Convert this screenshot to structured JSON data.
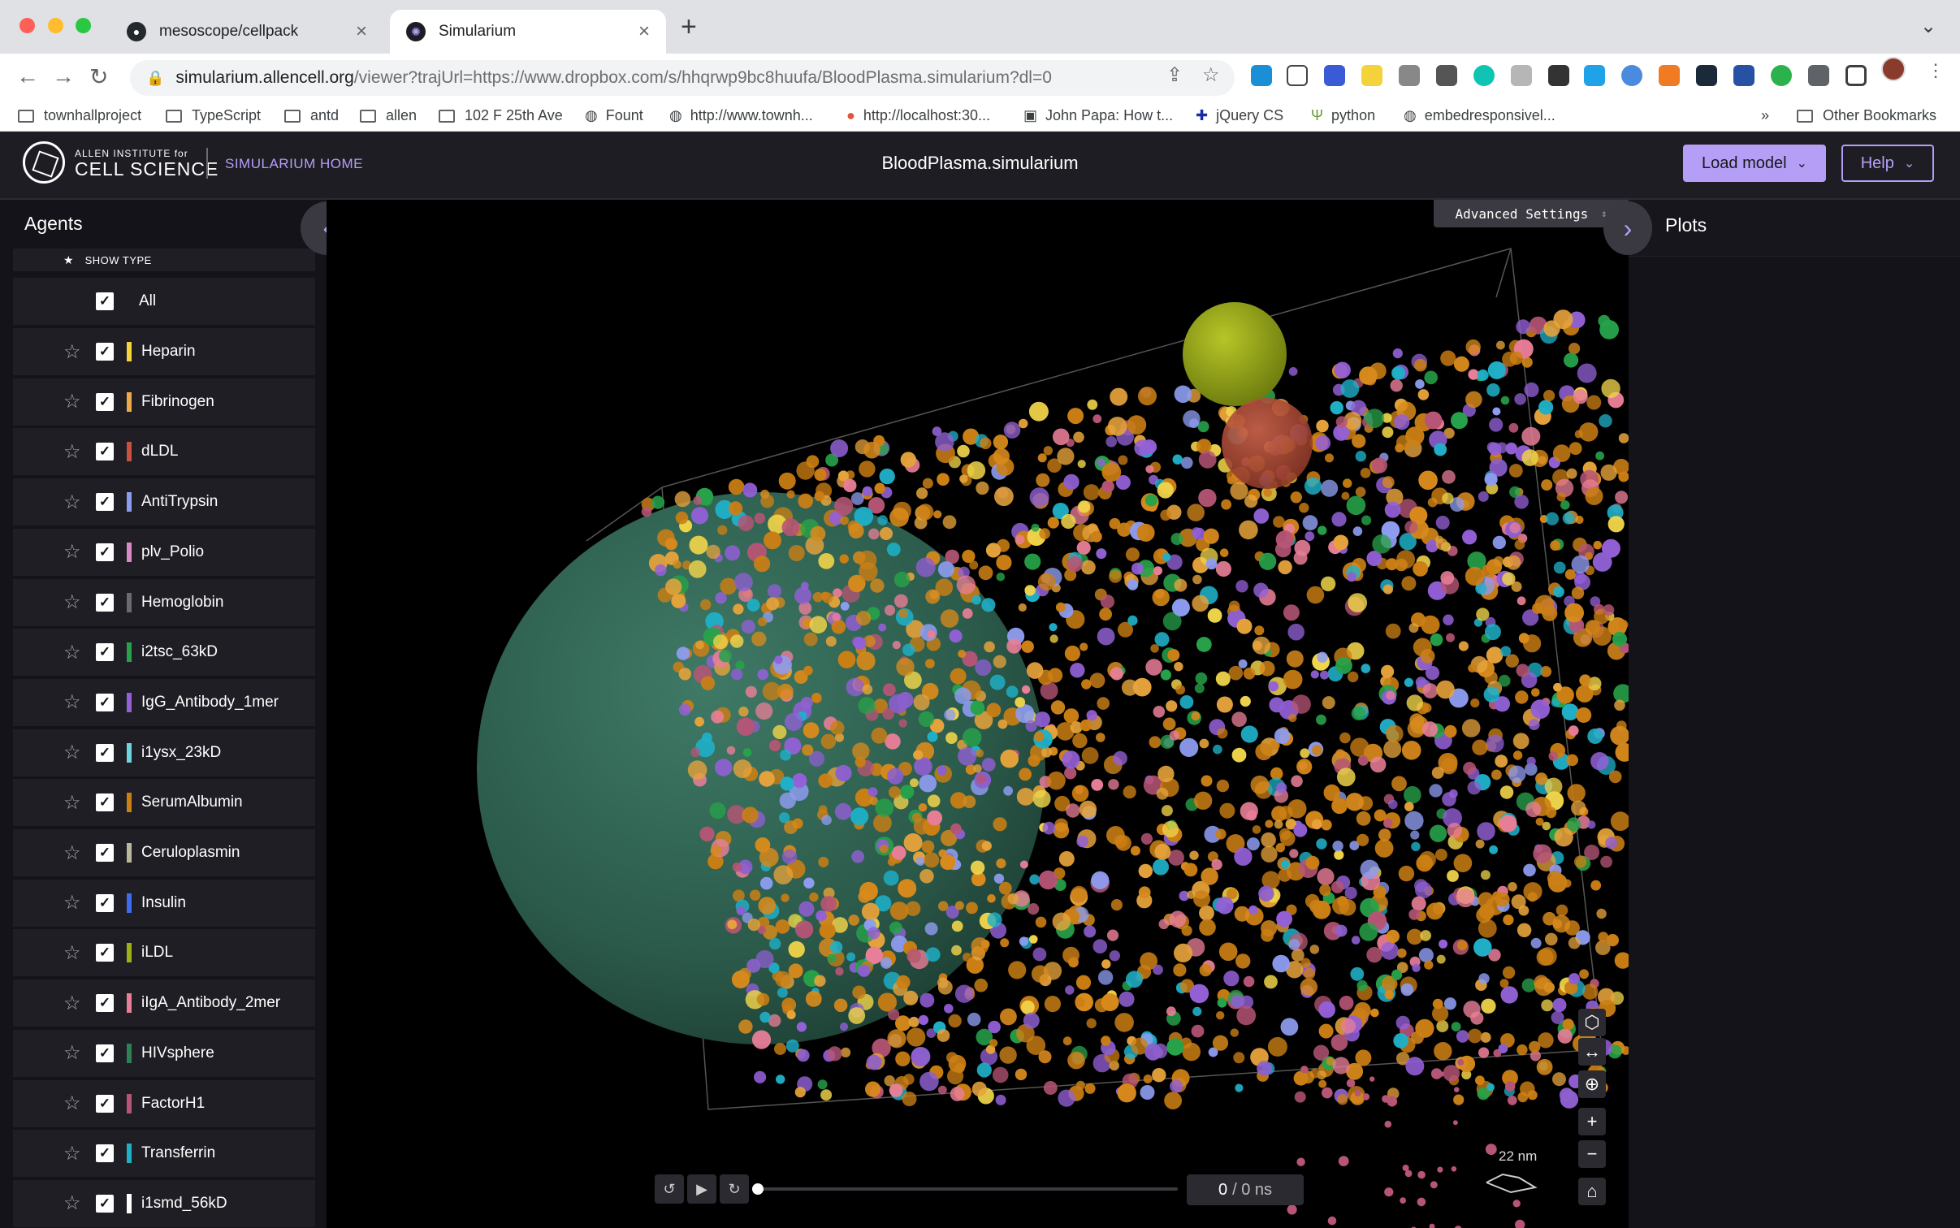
{
  "browser": {
    "tabs": [
      {
        "title": "mesoscope/cellpack",
        "icon": "github-icon"
      },
      {
        "title": "Simularium",
        "icon": "simularium-icon"
      }
    ],
    "url_host": "simularium.allencell.org",
    "url_path": "/viewer?trajUrl=https://www.dropbox.com/s/hhqrwp9bc8huufa/BloodPlasma.simularium?dl=0",
    "bookmarks": [
      {
        "label": "townhallproject",
        "icon": "folder-icon"
      },
      {
        "label": "TypeScript",
        "icon": "folder-icon"
      },
      {
        "label": "antd",
        "icon": "folder-icon"
      },
      {
        "label": "allen",
        "icon": "folder-icon"
      },
      {
        "label": "102 F 25th Ave",
        "icon": "folder-icon"
      },
      {
        "label": "Fount",
        "icon": "globe-icon"
      },
      {
        "label": "http://www.townh...",
        "icon": "globe-icon"
      },
      {
        "label": "http://localhost:30...",
        "icon": "dot-icon"
      },
      {
        "label": "John Papa: How t...",
        "icon": "doc-icon"
      },
      {
        "label": "jQuery CS",
        "icon": "puzzle-icon"
      },
      {
        "label": "python",
        "icon": "leaf-icon"
      },
      {
        "label": "embedresponsivel...",
        "icon": "globe-icon"
      }
    ],
    "bookmarks_overflow": "»",
    "other_bookmarks": "Other Bookmarks"
  },
  "header": {
    "org_line1": "ALLEN INSTITUTE for",
    "org_line2": "CELL SCIENCE",
    "home_link": "SIMULARIUM HOME",
    "title": "BloodPlasma.simularium",
    "load_model": "Load model",
    "help": "Help"
  },
  "agents_panel": {
    "title": "Agents",
    "show_type": "SHOW TYPE",
    "all_label": "All",
    "agents": [
      {
        "name": "Heparin",
        "color": "#f5d33d"
      },
      {
        "name": "Fibrinogen",
        "color": "#f0a94a"
      },
      {
        "name": "dLDL",
        "color": "#c7533f"
      },
      {
        "name": "AntiTrypsin",
        "color": "#8e9cf0"
      },
      {
        "name": "plv_Polio",
        "color": "#d889c6"
      },
      {
        "name": "Hemoglobin",
        "color": "#6a6a72"
      },
      {
        "name": "i2tsc_63kD",
        "color": "#27a24a"
      },
      {
        "name": "IgG_Antibody_1mer",
        "color": "#9460d8"
      },
      {
        "name": "i1ysx_23kD",
        "color": "#6fd3e0"
      },
      {
        "name": "SerumAlbumin",
        "color": "#cc7f14"
      },
      {
        "name": "Ceruloplasmin",
        "color": "#b9b89e"
      },
      {
        "name": "Insulin",
        "color": "#3c6df0"
      },
      {
        "name": "iLDL",
        "color": "#9cb017"
      },
      {
        "name": "iIgA_Antibody_2mer",
        "color": "#e87e97"
      },
      {
        "name": "HIVsphere",
        "color": "#2e8055"
      },
      {
        "name": "FactorH1",
        "color": "#b65576"
      },
      {
        "name": "Transferrin",
        "color": "#1fb0c8"
      },
      {
        "name": "i1smd_56kD",
        "color": "#ffffff"
      }
    ]
  },
  "viewer": {
    "advanced_settings": "Advanced Settings",
    "time_current": "0",
    "time_total": "/ 0 ns",
    "scale_bar": "22 nm"
  },
  "plots_panel": {
    "title": "Plots"
  }
}
